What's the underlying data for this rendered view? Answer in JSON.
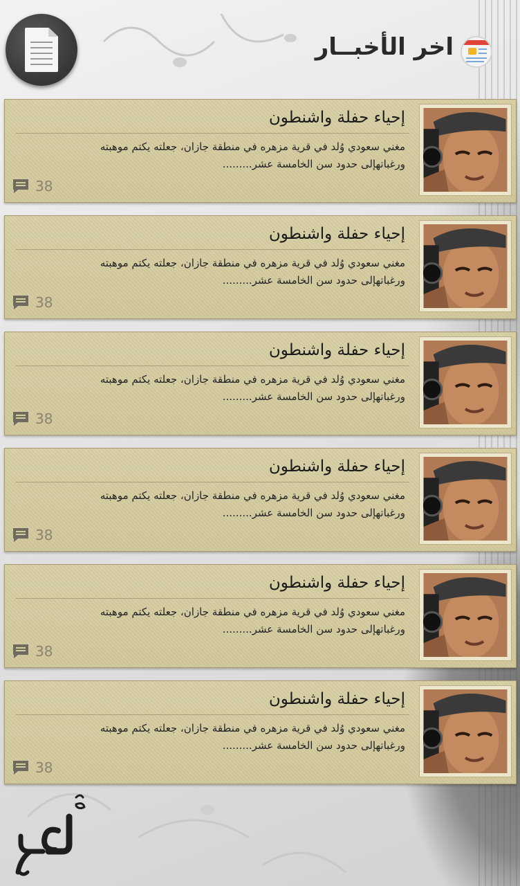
{
  "header": {
    "title": "اخر الأخبــار",
    "menu_icon": "document-icon",
    "title_icon": "news-icon"
  },
  "news": [
    {
      "title": "إحياء حفلة واشنطون",
      "desc_line1": "مغني سعودي وُلد في قرية مزهره في منطقة جازان، جعلته يكتم موهبته",
      "desc_line2": "ورغباتهإلى حدود سن الخامسة عشر.........",
      "comments": "38"
    },
    {
      "title": "إحياء حفلة واشنطون",
      "desc_line1": "مغني سعودي وُلد في قرية مزهره في منطقة جازان، جعلته يكتم موهبته",
      "desc_line2": "ورغباتهإلى حدود سن الخامسة عشر.........",
      "comments": "38"
    },
    {
      "title": "إحياء حفلة واشنطون",
      "desc_line1": "مغني سعودي وُلد في قرية مزهره في منطقة جازان، جعلته يكتم موهبته",
      "desc_line2": "ورغباتهإلى حدود سن الخامسة عشر.........",
      "comments": "38"
    },
    {
      "title": "إحياء حفلة واشنطون",
      "desc_line1": "مغني سعودي وُلد في قرية مزهره في منطقة جازان، جعلته يكتم موهبته",
      "desc_line2": "ورغباتهإلى حدود سن الخامسة عشر.........",
      "comments": "38"
    },
    {
      "title": "إحياء حفلة واشنطون",
      "desc_line1": "مغني سعودي وُلد في قرية مزهره في منطقة جازان، جعلته يكتم موهبته",
      "desc_line2": "ورغباتهإلى حدود سن الخامسة عشر.........",
      "comments": "38"
    },
    {
      "title": "إحياء حفلة واشنطون",
      "desc_line1": "مغني سعودي وُلد في قرية مزهره في منطقة جازان، جعلته يكتم موهبته",
      "desc_line2": "ورغباتهإلى حدود سن الخامسة عشر.........",
      "comments": "38"
    }
  ],
  "footer": {
    "logo_text": "حكمي"
  },
  "colors": {
    "card_bg": "#d6cda1",
    "card_border": "#a59c76",
    "menu_button": "#3b3b3b"
  }
}
